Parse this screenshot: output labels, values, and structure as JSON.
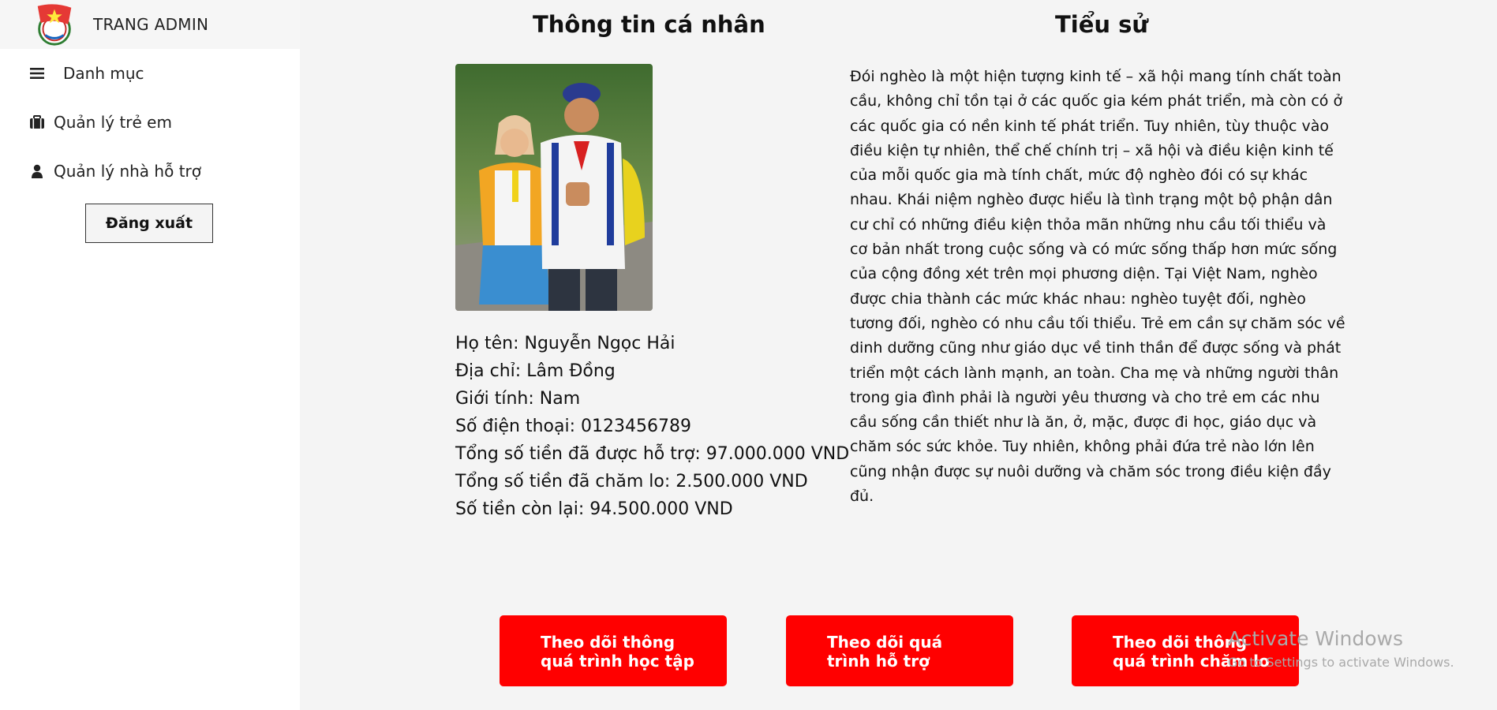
{
  "sidebar": {
    "brand_title": "TRANG ADMIN",
    "logo_icon": "youth-union-flag-logo",
    "menu_header": {
      "icon": "hamburger-icon",
      "label": "Danh mục"
    },
    "items": [
      {
        "icon": "briefcase-icon",
        "label": "Quản lý trẻ em"
      },
      {
        "icon": "user-icon",
        "label": "Quản lý nhà hỗ trợ"
      }
    ],
    "logout_label": "Đăng xuất"
  },
  "profile": {
    "title": "Thông tin cá nhân",
    "fields": [
      "Họ tên: Nguyễn Ngọc Hải",
      "Địa chỉ: Lâm Đồng",
      "Giới tính: Nam",
      "Số điện thoại: 0123456789",
      "Tổng số tiền đã được hỗ trợ: 97.000.000 VND",
      "Tổng số tiền đã chăm lo: 2.500.000 VND",
      "Số tiền còn lại: 94.500.000 VND"
    ]
  },
  "bio": {
    "title": "Tiểu sử",
    "text": "Đói nghèo là một hiện tượng kinh tế – xã hội mang tính chất toàn cầu, không chỉ tồn tại ở các quốc gia kém phát triển, mà còn có ở các quốc gia có nền kinh tế phát triển. Tuy nhiên, tùy thuộc vào điều kiện tự nhiên, thể chế chính trị – xã hội và điều kiện kinh tế của mỗi quốc gia mà tính chất, mức độ nghèo đói có sự khác nhau. Khái niệm nghèo được hiểu là tình trạng một bộ phận dân cư chỉ có những điều kiện thỏa mãn những nhu cầu tối thiểu và cơ bản nhất trong cuộc sống và có mức sống thấp hơn mức sống của cộng đồng xét trên mọi phương diện. Tại Việt Nam, nghèo được chia thành các mức khác nhau: nghèo tuyệt đối, nghèo tương đối, nghèo có nhu cầu tối thiểu. Trẻ em cần sự chăm sóc về dinh dưỡng cũng như giáo dục về tinh thần để được sống và phát triển một cách lành mạnh, an toàn. Cha mẹ và những người thân trong gia đình phải là người yêu thương và cho trẻ em các nhu cầu sống cần thiết như là ăn, ở, mặc, được đi học, giáo dục và chăm sóc sức khỏe. Tuy nhiên, không phải đứa trẻ nào lớn lên cũng nhận được sự nuôi dưỡng và chăm sóc trong điều kiện đầy đủ."
  },
  "actions": [
    {
      "line1": "Theo dõi thông",
      "line2": "quá trình học tập"
    },
    {
      "line1": "Theo dõi quá",
      "line2": "trình hỗ trợ"
    },
    {
      "line1": "Theo dõi thông",
      "line2": "quá trình chăm lo"
    }
  ],
  "watermark": {
    "title": "Activate Windows",
    "subtitle": "Go to Settings to activate Windows."
  },
  "colors": {
    "action_red": "#ff0000",
    "main_bg": "#f4f4f4",
    "brand_bg": "#f6f6f6"
  }
}
